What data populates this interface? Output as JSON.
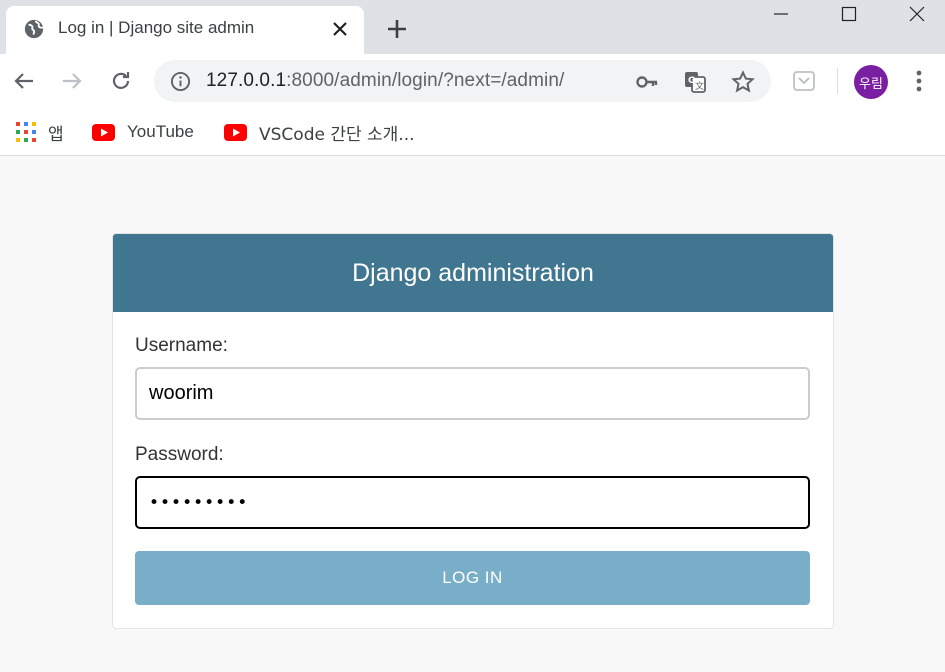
{
  "browser": {
    "tab": {
      "title": "Log in | Django site admin",
      "icon": "globe-icon"
    },
    "address": {
      "host": "127.0.0.1",
      "rest": ":8000/admin/login/?next=/admin/"
    },
    "profile": {
      "initials": "우림",
      "color": "#7b1fa2"
    },
    "bookmarks": [
      {
        "label": "앱",
        "icon": "apps-grid-icon"
      },
      {
        "label": "YouTube",
        "icon": "youtube-icon"
      },
      {
        "label": "VSCode 간단 소개...",
        "icon": "youtube-icon"
      }
    ]
  },
  "login": {
    "header": "Django administration",
    "username_label": "Username:",
    "username_value": "woorim",
    "password_label": "Password:",
    "password_value": "•••••••••",
    "submit_label": "LOG IN"
  },
  "colors": {
    "header_bg": "#417690",
    "button_bg": "#79aec8",
    "page_bg": "#f8f8f8"
  }
}
